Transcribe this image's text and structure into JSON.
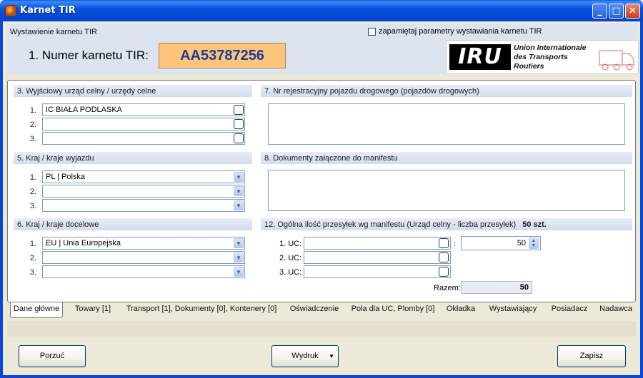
{
  "window": {
    "title": "Karnet TIR"
  },
  "header": {
    "section_label": "Wystawienie karnetu TIR",
    "remember_label": "zapamiętaj parametry wystawiania karnetu TIR",
    "karnet_label": "1. Numer karnetu TIR:",
    "karnet_number": "AA53787256"
  },
  "logo": {
    "mark": "IRU",
    "line1": "Union Internationale",
    "line2": "des Transports",
    "line3": "Routiers"
  },
  "sections": {
    "customs": {
      "title": "3. Wyjściowy urząd celny / urzędy celne",
      "rows": [
        {
          "num": "1.",
          "value": "IC BIAŁA PODLASKA"
        },
        {
          "num": "2.",
          "value": ""
        },
        {
          "num": "3.",
          "value": ""
        }
      ]
    },
    "exit_country": {
      "title": "5. Kraj / kraje wyjazdu",
      "rows": [
        {
          "num": "1.",
          "value": "PL | Polska"
        },
        {
          "num": "2.",
          "value": ""
        },
        {
          "num": "3.",
          "value": ""
        }
      ]
    },
    "dest_country": {
      "title": "6. Kraj / kraje docelowe",
      "rows": [
        {
          "num": "1.",
          "value": "EU | Unia Europejska"
        },
        {
          "num": "2.",
          "value": ""
        },
        {
          "num": "3.",
          "value": ""
        }
      ]
    },
    "vehicle": {
      "title": "7. Nr rejestracyjny pojazdu drogowego (pojazdów drogowych)"
    },
    "documents": {
      "title": "8. Dokumenty załączone do manifestu"
    },
    "shipments": {
      "title": "12. Ogólna ilość przesyłek wg manifestu (Urząd celny - liczba przesyłek)",
      "total_label": "50 szt.",
      "rows": [
        {
          "label": "1. UC:",
          "value": ""
        },
        {
          "label": "2. UC:",
          "value": ""
        },
        {
          "label": "3. UC:",
          "value": ""
        }
      ],
      "colon": ":",
      "count_value": "50",
      "razem_label": "Razem:",
      "razem_value": "50"
    }
  },
  "tabs": [
    "Dane główne",
    "Towary [1]",
    "Transport [1], Dokumenty [0], Kontenery [0]",
    "Oświadczenie",
    "Pola dla UC, Plomby [0]",
    "Okładka",
    "Wystawiający",
    "Posiadacz",
    "Nadawca"
  ],
  "buttons": {
    "porzuc": "Porzuć",
    "wydruk": "Wydruk",
    "zapisz": "Zapisz"
  },
  "glyphs": {
    "minimize": "_",
    "maximize": "□",
    "close": "✕",
    "dropdown": "▼",
    "spin_up": "▲",
    "spin_down": "▼"
  }
}
